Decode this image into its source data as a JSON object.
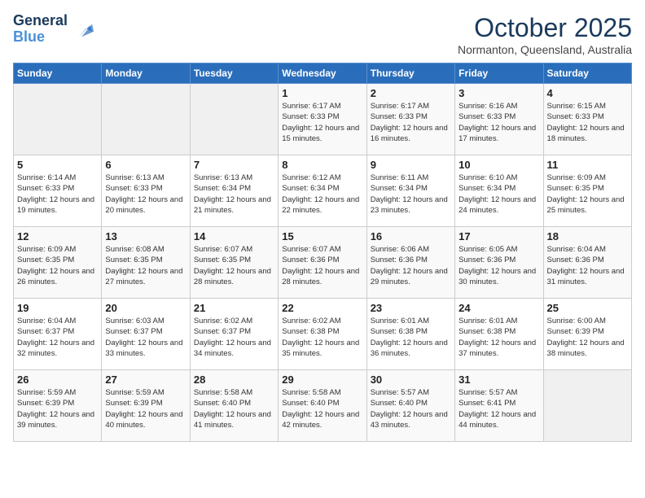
{
  "header": {
    "logo_line1": "General",
    "logo_line2": "Blue",
    "month": "October 2025",
    "location": "Normanton, Queensland, Australia"
  },
  "weekdays": [
    "Sunday",
    "Monday",
    "Tuesday",
    "Wednesday",
    "Thursday",
    "Friday",
    "Saturday"
  ],
  "weeks": [
    [
      {
        "day": "",
        "info": ""
      },
      {
        "day": "",
        "info": ""
      },
      {
        "day": "",
        "info": ""
      },
      {
        "day": "1",
        "info": "Sunrise: 6:17 AM\nSunset: 6:33 PM\nDaylight: 12 hours\nand 15 minutes."
      },
      {
        "day": "2",
        "info": "Sunrise: 6:17 AM\nSunset: 6:33 PM\nDaylight: 12 hours\nand 16 minutes."
      },
      {
        "day": "3",
        "info": "Sunrise: 6:16 AM\nSunset: 6:33 PM\nDaylight: 12 hours\nand 17 minutes."
      },
      {
        "day": "4",
        "info": "Sunrise: 6:15 AM\nSunset: 6:33 PM\nDaylight: 12 hours\nand 18 minutes."
      }
    ],
    [
      {
        "day": "5",
        "info": "Sunrise: 6:14 AM\nSunset: 6:33 PM\nDaylight: 12 hours\nand 19 minutes."
      },
      {
        "day": "6",
        "info": "Sunrise: 6:13 AM\nSunset: 6:33 PM\nDaylight: 12 hours\nand 20 minutes."
      },
      {
        "day": "7",
        "info": "Sunrise: 6:13 AM\nSunset: 6:34 PM\nDaylight: 12 hours\nand 21 minutes."
      },
      {
        "day": "8",
        "info": "Sunrise: 6:12 AM\nSunset: 6:34 PM\nDaylight: 12 hours\nand 22 minutes."
      },
      {
        "day": "9",
        "info": "Sunrise: 6:11 AM\nSunset: 6:34 PM\nDaylight: 12 hours\nand 23 minutes."
      },
      {
        "day": "10",
        "info": "Sunrise: 6:10 AM\nSunset: 6:34 PM\nDaylight: 12 hours\nand 24 minutes."
      },
      {
        "day": "11",
        "info": "Sunrise: 6:09 AM\nSunset: 6:35 PM\nDaylight: 12 hours\nand 25 minutes."
      }
    ],
    [
      {
        "day": "12",
        "info": "Sunrise: 6:09 AM\nSunset: 6:35 PM\nDaylight: 12 hours\nand 26 minutes."
      },
      {
        "day": "13",
        "info": "Sunrise: 6:08 AM\nSunset: 6:35 PM\nDaylight: 12 hours\nand 27 minutes."
      },
      {
        "day": "14",
        "info": "Sunrise: 6:07 AM\nSunset: 6:35 PM\nDaylight: 12 hours\nand 28 minutes."
      },
      {
        "day": "15",
        "info": "Sunrise: 6:07 AM\nSunset: 6:36 PM\nDaylight: 12 hours\nand 28 minutes."
      },
      {
        "day": "16",
        "info": "Sunrise: 6:06 AM\nSunset: 6:36 PM\nDaylight: 12 hours\nand 29 minutes."
      },
      {
        "day": "17",
        "info": "Sunrise: 6:05 AM\nSunset: 6:36 PM\nDaylight: 12 hours\nand 30 minutes."
      },
      {
        "day": "18",
        "info": "Sunrise: 6:04 AM\nSunset: 6:36 PM\nDaylight: 12 hours\nand 31 minutes."
      }
    ],
    [
      {
        "day": "19",
        "info": "Sunrise: 6:04 AM\nSunset: 6:37 PM\nDaylight: 12 hours\nand 32 minutes."
      },
      {
        "day": "20",
        "info": "Sunrise: 6:03 AM\nSunset: 6:37 PM\nDaylight: 12 hours\nand 33 minutes."
      },
      {
        "day": "21",
        "info": "Sunrise: 6:02 AM\nSunset: 6:37 PM\nDaylight: 12 hours\nand 34 minutes."
      },
      {
        "day": "22",
        "info": "Sunrise: 6:02 AM\nSunset: 6:38 PM\nDaylight: 12 hours\nand 35 minutes."
      },
      {
        "day": "23",
        "info": "Sunrise: 6:01 AM\nSunset: 6:38 PM\nDaylight: 12 hours\nand 36 minutes."
      },
      {
        "day": "24",
        "info": "Sunrise: 6:01 AM\nSunset: 6:38 PM\nDaylight: 12 hours\nand 37 minutes."
      },
      {
        "day": "25",
        "info": "Sunrise: 6:00 AM\nSunset: 6:39 PM\nDaylight: 12 hours\nand 38 minutes."
      }
    ],
    [
      {
        "day": "26",
        "info": "Sunrise: 5:59 AM\nSunset: 6:39 PM\nDaylight: 12 hours\nand 39 minutes."
      },
      {
        "day": "27",
        "info": "Sunrise: 5:59 AM\nSunset: 6:39 PM\nDaylight: 12 hours\nand 40 minutes."
      },
      {
        "day": "28",
        "info": "Sunrise: 5:58 AM\nSunset: 6:40 PM\nDaylight: 12 hours\nand 41 minutes."
      },
      {
        "day": "29",
        "info": "Sunrise: 5:58 AM\nSunset: 6:40 PM\nDaylight: 12 hours\nand 42 minutes."
      },
      {
        "day": "30",
        "info": "Sunrise: 5:57 AM\nSunset: 6:40 PM\nDaylight: 12 hours\nand 43 minutes."
      },
      {
        "day": "31",
        "info": "Sunrise: 5:57 AM\nSunset: 6:41 PM\nDaylight: 12 hours\nand 44 minutes."
      },
      {
        "day": "",
        "info": ""
      }
    ]
  ]
}
